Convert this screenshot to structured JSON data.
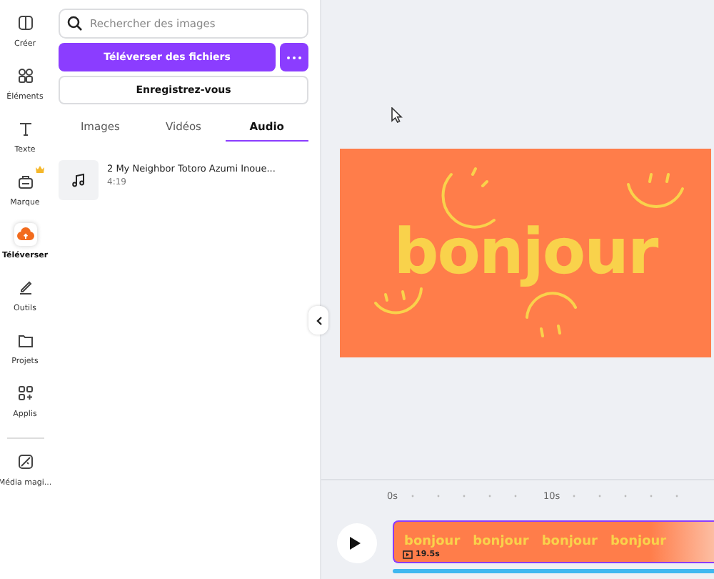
{
  "rail": [
    {
      "label": "Créer",
      "selected": false,
      "premium": false
    },
    {
      "label": "Éléments",
      "selected": false,
      "premium": false
    },
    {
      "label": "Texte",
      "selected": false,
      "premium": false
    },
    {
      "label": "Marque",
      "selected": false,
      "premium": true
    },
    {
      "label": "Téléverser",
      "selected": true,
      "premium": false
    },
    {
      "label": "Outils",
      "selected": false,
      "premium": false
    },
    {
      "label": "Projets",
      "selected": false,
      "premium": false
    },
    {
      "label": "Applis",
      "selected": false,
      "premium": false
    },
    {
      "label": "Média magi...",
      "selected": false,
      "premium": false
    }
  ],
  "search": {
    "placeholder": "Rechercher des images"
  },
  "upload_button": "Téléverser des fichiers",
  "record_button": "Enregistrez-vous",
  "tabs": [
    {
      "label": "Images",
      "selected": false
    },
    {
      "label": "Vidéos",
      "selected": false
    },
    {
      "label": "Audio",
      "selected": true
    }
  ],
  "audio_items": [
    {
      "title": "2 My Neighbor Totoro Azumi Inoue...",
      "duration": "4:19"
    }
  ],
  "design": {
    "text": "bonjour"
  },
  "timeline": {
    "ruler": [
      "0s",
      "10s"
    ],
    "clip": {
      "thumbnails": [
        "bonjour",
        "bonjour",
        "bonjour",
        "bonjour"
      ],
      "duration": "19.5s"
    }
  }
}
